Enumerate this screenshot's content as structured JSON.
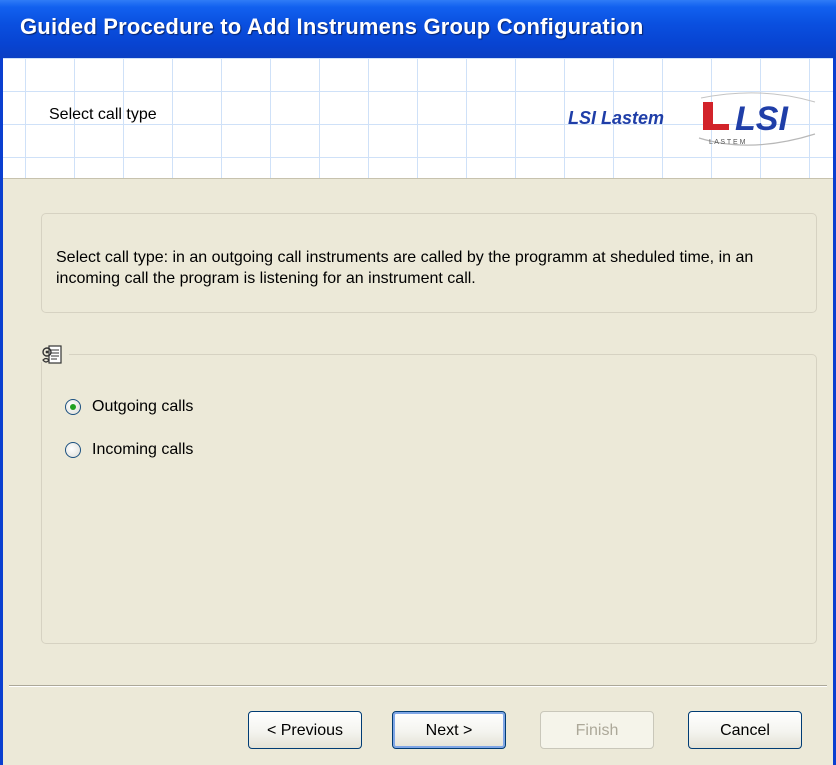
{
  "window": {
    "title": "Guided Procedure to Add Instrumens Group Configuration"
  },
  "header": {
    "subtitle": "Select call type",
    "logo_text": "LSI Lastem",
    "logo_mark_letters": "LSI",
    "logo_mark_subtext": "L A S T E M"
  },
  "description": {
    "text": "Select call type: in an outgoing call instruments are called by the programm at sheduled time, in an incoming call the program is listening for an instrument call."
  },
  "call_type": {
    "icon": "settings-document-icon",
    "options": [
      {
        "label": "Outgoing calls",
        "checked": true
      },
      {
        "label": "Incoming calls",
        "checked": false
      }
    ]
  },
  "buttons": {
    "previous": "< Previous",
    "next": "Next >",
    "finish": "Finish",
    "cancel": "Cancel"
  },
  "colors": {
    "titlebar": "#0a50e0",
    "dialog_bg": "#ece9d8",
    "logo_blue": "#1f3ea8",
    "logo_red": "#d2232a",
    "radio_dot": "#21a121"
  }
}
